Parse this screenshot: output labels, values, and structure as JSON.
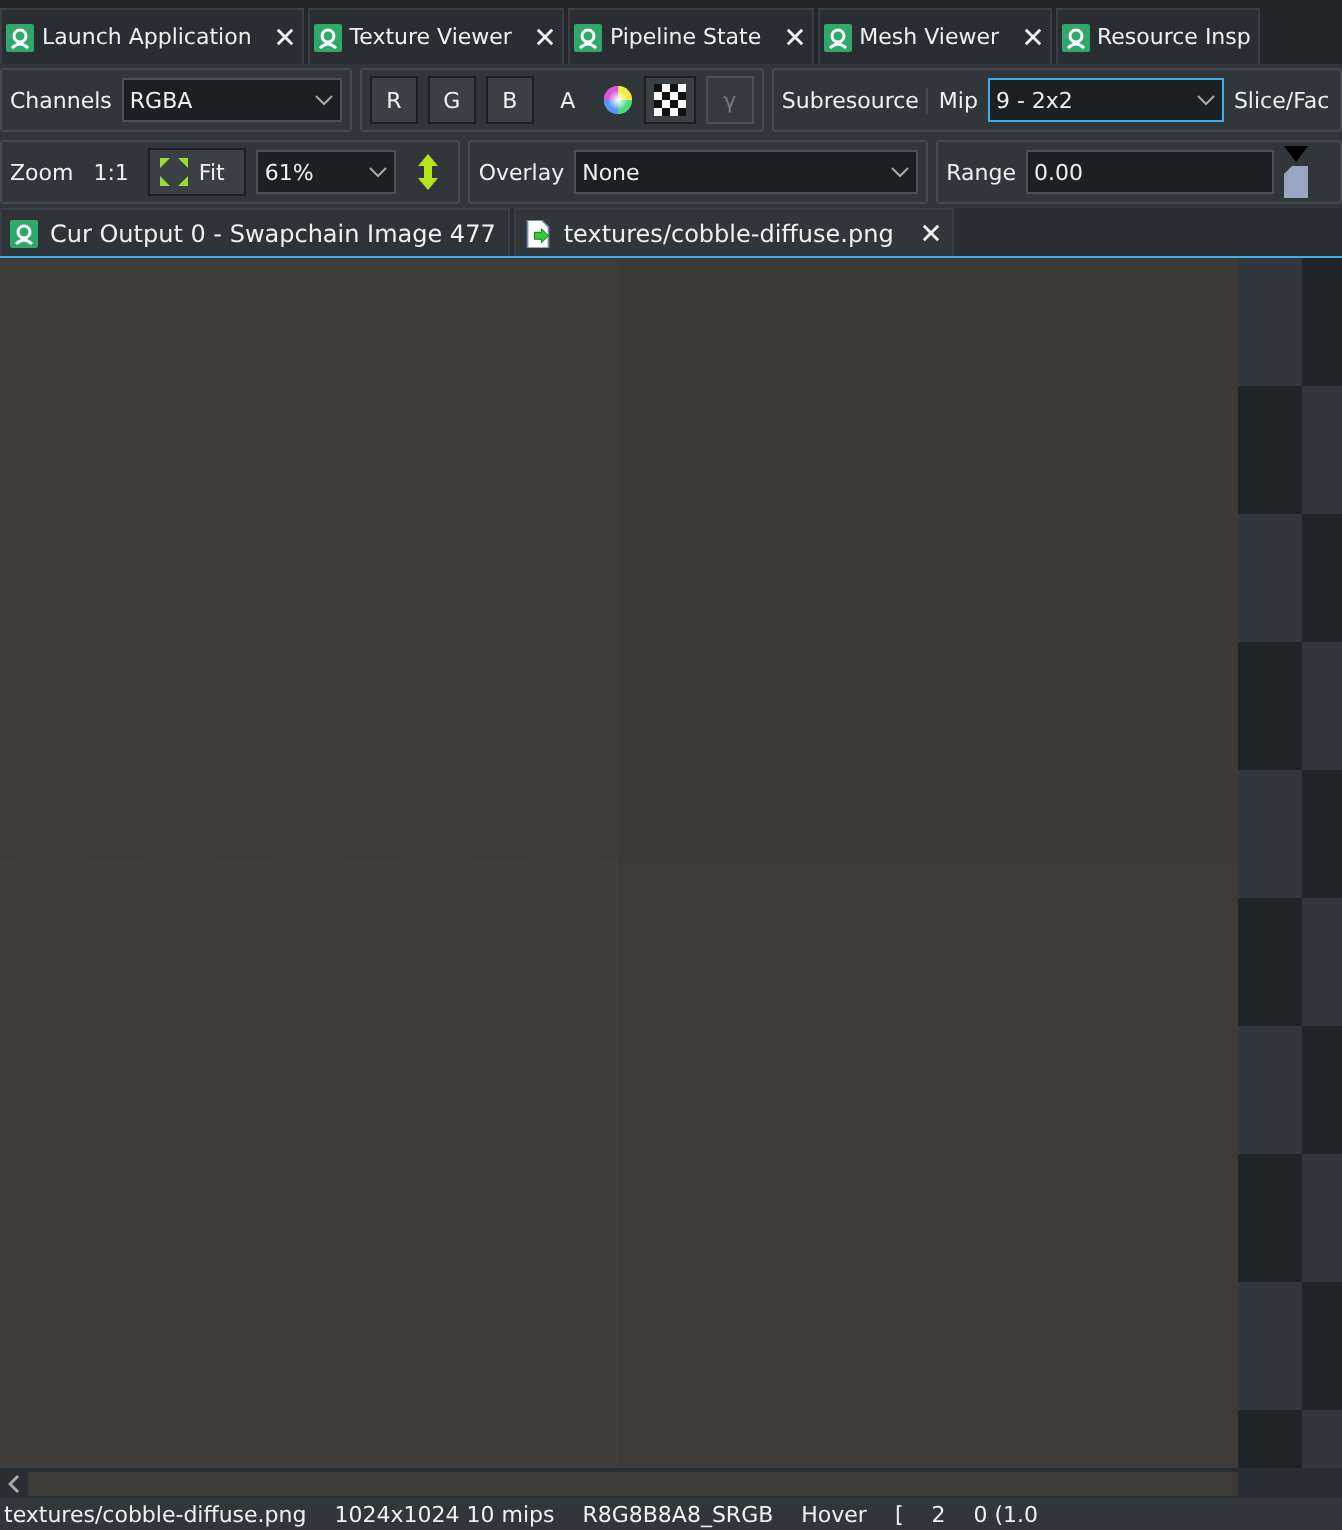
{
  "app_tabs": [
    {
      "label": "Launch Application"
    },
    {
      "label": "Texture Viewer"
    },
    {
      "label": "Pipeline State"
    },
    {
      "label": "Mesh Viewer"
    },
    {
      "label": "Resource Insp"
    }
  ],
  "toolbar": {
    "channels_label": "Channels",
    "channels_value": "RGBA",
    "channel_buttons": [
      {
        "label": "R",
        "selected": true
      },
      {
        "label": "G",
        "selected": true
      },
      {
        "label": "B",
        "selected": true
      },
      {
        "label": "A",
        "selected": false
      }
    ],
    "checker_selected": true,
    "gamma_label": "γ",
    "subresource_label": "Subresource",
    "mip_label": "Mip",
    "mip_value": "9 - 2x2",
    "slice_label": "Slice/Fac",
    "zoom_label": "Zoom",
    "zoom_one": "1:1",
    "fit_label": "Fit",
    "fit_selected": true,
    "zoom_value": "61%",
    "overlay_label": "Overlay",
    "overlay_value": "None",
    "range_label": "Range",
    "range_value": "0.00"
  },
  "doc_tabs": [
    {
      "label": "Cur Output 0 - Swapchain Image 477",
      "kind": "output",
      "selected": false
    },
    {
      "label": "textures/cobble-diffuse.png",
      "kind": "file",
      "selected": true
    }
  ],
  "status_bar": [
    "textures/cobble-diffuse.png",
    "1024x1024 10 mips",
    "R8G8B8A8_SRGB",
    "Hover",
    "[",
    "2",
    "0 (1.0"
  ]
}
